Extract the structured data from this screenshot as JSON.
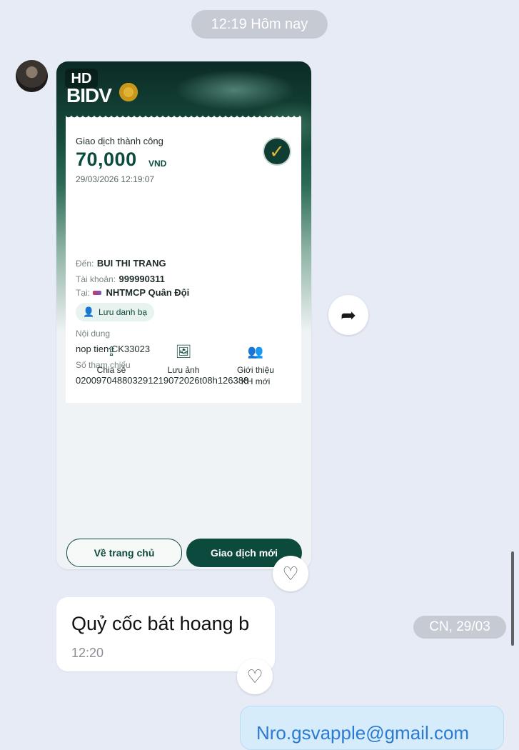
{
  "chat": {
    "time_separator": "12:19 Hôm nay",
    "date_separator": "CN, 29/03"
  },
  "receipt_card": {
    "brand_badge": "HD",
    "brand_name": "BIDV",
    "status": "Giao dịch thành công",
    "amount": "70,000",
    "currency": "VND",
    "datetime": "29/03/2026 12:19:07",
    "to_label": "Đến:",
    "to_value": "BUI THI TRANG",
    "account_label": "Tài khoản:",
    "account_value": "999990311",
    "bank_label": "Tại:",
    "bank_value": "NHTMCP Quân Đội",
    "save_contact": "Lưu danh bạ",
    "content_label": "Nội dung",
    "content_value": "nop tien CK33023",
    "reference_label": "Số tham chiếu",
    "reference_value": "020097048803291219072026t08h126388",
    "actions": [
      {
        "icon": "share-icon",
        "label": "Chia sẻ"
      },
      {
        "icon": "save-image-icon",
        "label": "Lưu ảnh"
      },
      {
        "icon": "refer-users-icon",
        "label": "Giới thiệu\nKH mới"
      }
    ],
    "home_button": "Về trang chủ",
    "new_transaction_button": "Giao dịch mới"
  },
  "messages": [
    {
      "text": "Quỷ cốc bát hoang b",
      "time": "12:20"
    }
  ],
  "own_message": {
    "text": "Nro.gsvapple@gmail.com"
  },
  "colors": {
    "accent": "#0d4a3e",
    "background": "#e7ebf5",
    "pill": "#c6cad3"
  }
}
